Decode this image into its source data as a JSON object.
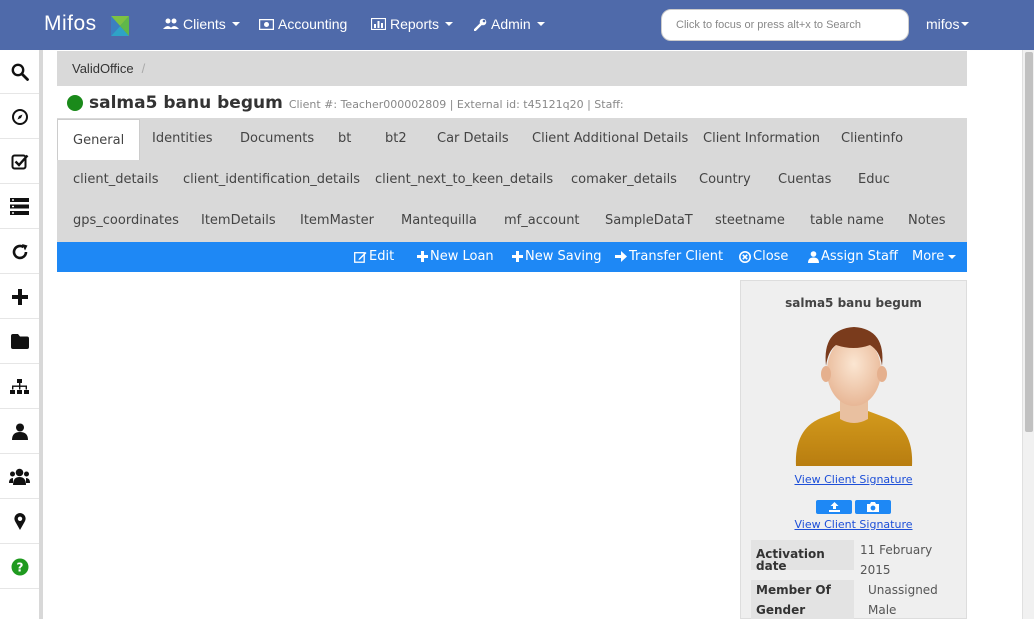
{
  "app": {
    "logo": "Mifos"
  },
  "nav": {
    "clients": "Clients",
    "accounting": "Accounting",
    "reports": "Reports",
    "admin": "Admin"
  },
  "search": {
    "placeholder": "Click to focus or press alt+x to Search"
  },
  "user": {
    "name": "mifos"
  },
  "sidebar": {
    "items": [
      "search-icon",
      "compass-icon",
      "checkbox-icon",
      "list-icon",
      "refresh-icon",
      "plus-icon",
      "folder-icon",
      "sitemap-icon",
      "user-icon",
      "users-icon",
      "map-marker-icon",
      "help-icon"
    ]
  },
  "breadcrumb": {
    "office": "ValidOffice",
    "separator": "/"
  },
  "client": {
    "name": "salma5 banu begum",
    "meta": "Client #: Teacher000002809 | External id: t45121q20 | Staff:",
    "status_color": "#1a8a1a"
  },
  "tabs": [
    [
      "General",
      "Identities",
      "Documents",
      "bt",
      "bt2",
      "Car Details",
      "Client Additional Details",
      "Client Information",
      "Clientinfo"
    ],
    [
      "client_details",
      "client_identification_details",
      "client_next_to_keen_details",
      "comaker_details",
      "Country",
      "Cuentas",
      "Educ"
    ],
    [
      "gps_coordinates",
      "ItemDetails",
      "ItemMaster",
      "Mantequilla",
      "mf_account",
      "SampleDataT",
      "steetname",
      "table name",
      "Notes"
    ]
  ],
  "actions": {
    "edit": "Edit",
    "new_loan": "New Loan",
    "new_saving": "New Saving",
    "transfer_client": "Transfer Client",
    "close": "Close",
    "assign_staff": "Assign Staff",
    "more": "More"
  },
  "profile": {
    "name": "salma5 banu begum",
    "view_signature": "View Client Signature",
    "view_signature_2": "View Client Signature",
    "fields": [
      {
        "label": "Activation date",
        "value": "11 February 2015"
      },
      {
        "label": "Member Of",
        "value": "Unassigned"
      },
      {
        "label": "Gender",
        "value": "Male"
      }
    ]
  },
  "colors": {
    "navbar": "#4f6aaa",
    "actionbar": "#1e88f5",
    "tab_background": "#d9d9d9"
  }
}
